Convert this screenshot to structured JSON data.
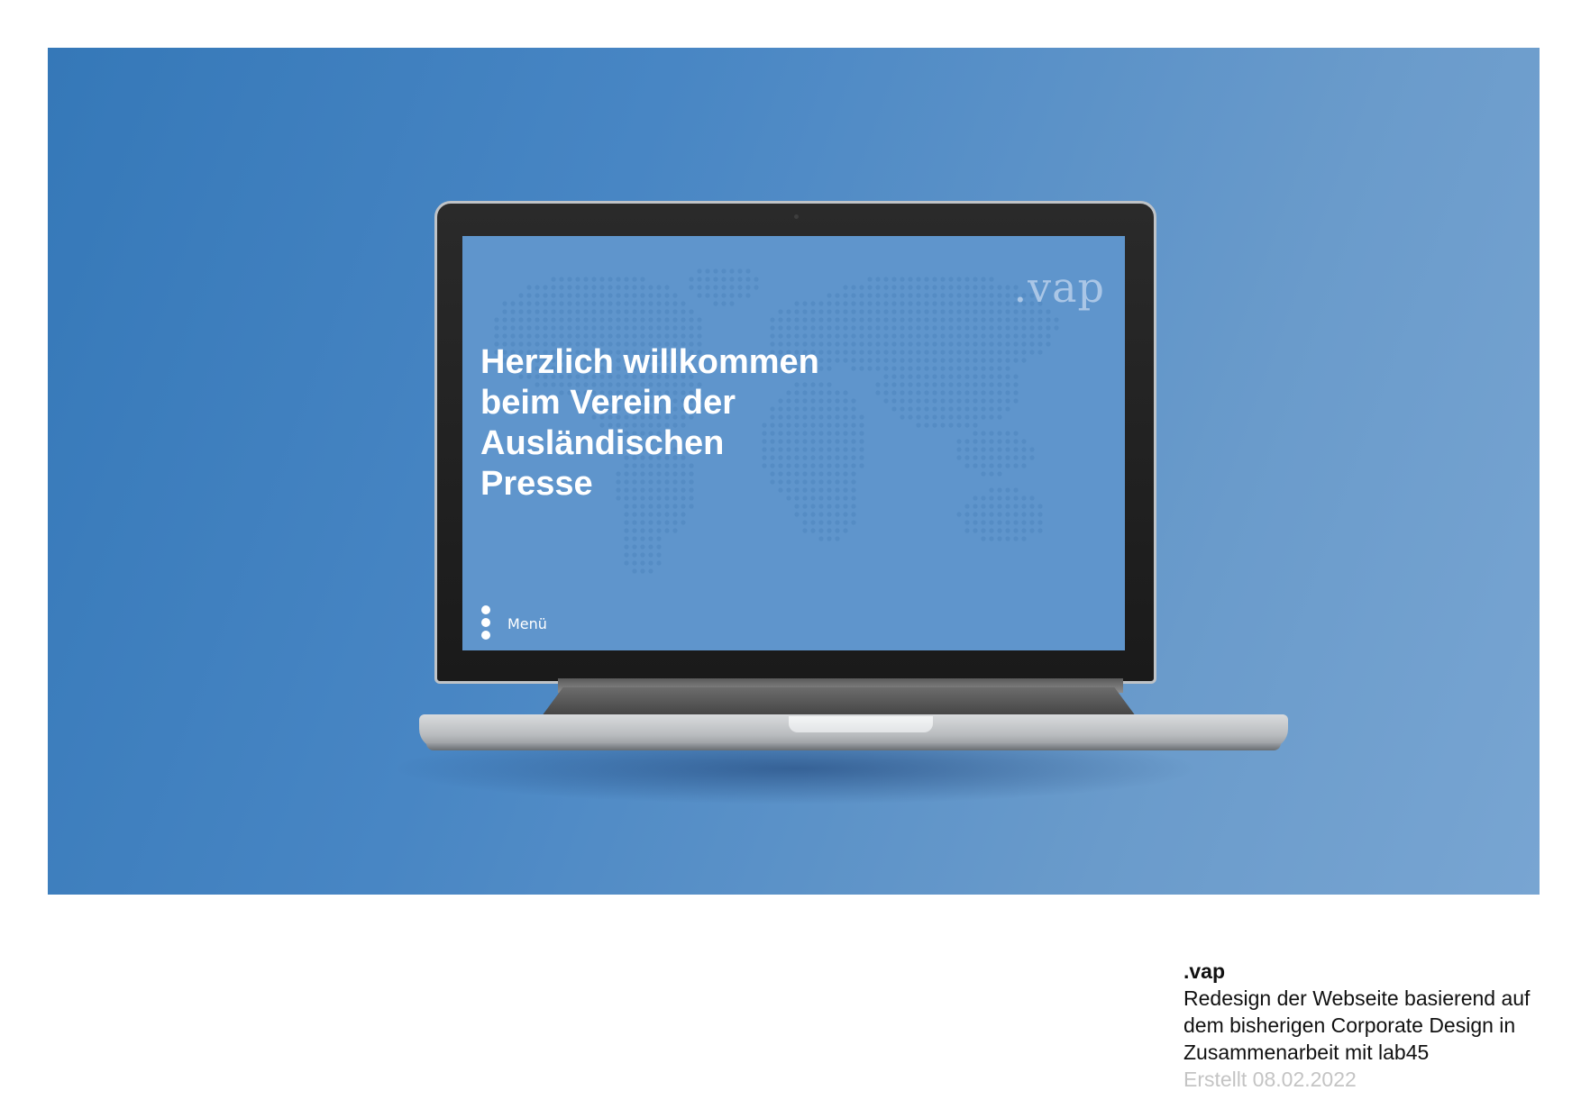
{
  "screen": {
    "logo": ".vap",
    "welcome_lines": [
      "Herzlich willkommen",
      "beim Verein der",
      "Ausländischen",
      "Presse"
    ],
    "menu_label": "Menü"
  },
  "caption": {
    "title": ".vap",
    "description_lines": [
      "Redesign der Webseite basierend auf",
      "dem bisherigen Corporate Design in",
      "Zusammenarbeit mit lab45"
    ],
    "date": "Erstellt 08.02.2022"
  },
  "colors": {
    "background_blue": "#4886c4",
    "screen_blue": "#5f95cc",
    "logo_color": "#aac6e6",
    "date_gray": "#c4c4c4"
  },
  "icons": {
    "menu": "vertical-dots-icon",
    "map": "dotted-world-map"
  }
}
